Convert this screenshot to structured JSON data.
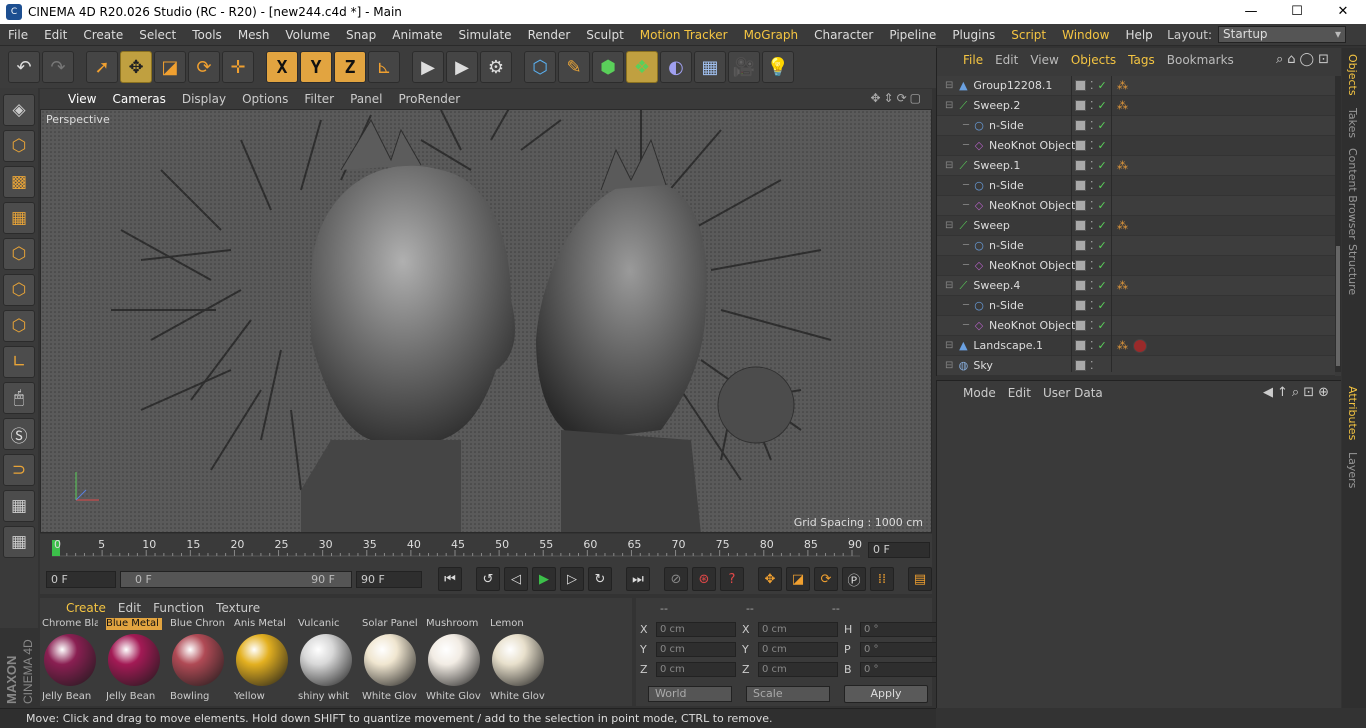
{
  "window": {
    "title": "CINEMA 4D R20.026 Studio (RC - R20) - [new244.c4d *] - Main",
    "minimize": "—",
    "maximize": "☐",
    "close": "✕"
  },
  "menubar": {
    "items": [
      "File",
      "Edit",
      "Create",
      "Select",
      "Tools",
      "Mesh",
      "Volume",
      "Snap",
      "Animate",
      "Simulate",
      "Render",
      "Sculpt",
      "Motion Tracker",
      "MoGraph",
      "Character",
      "Pipeline",
      "Plugins",
      "Script",
      "Window",
      "Help"
    ],
    "highlighted": [
      "Motion Tracker",
      "MoGraph",
      "Script",
      "Window"
    ],
    "layout_label": "Layout:",
    "layout_value": "Startup"
  },
  "viewport": {
    "menu": [
      "View",
      "Cameras",
      "Display",
      "Options",
      "Filter",
      "Panel",
      "ProRender"
    ],
    "label": "Perspective",
    "grid_spacing": "Grid Spacing : 1000 cm"
  },
  "timeline": {
    "ticks": [
      "0",
      "5",
      "10",
      "15",
      "20",
      "25",
      "30",
      "35",
      "40",
      "45",
      "50",
      "55",
      "60",
      "65",
      "70",
      "75",
      "80",
      "85",
      "90"
    ],
    "current_frame": "0 F"
  },
  "transport": {
    "start": "0 F",
    "range_start": "0 F",
    "range_end": "90 F",
    "end": "90 F"
  },
  "material_manager": {
    "menu": [
      "Create",
      "Edit",
      "Function",
      "Texture"
    ],
    "materials": [
      {
        "top": "Chrome Bla",
        "bottom": "Jelly Bean",
        "color": "#8a1f52",
        "selected": false
      },
      {
        "top": "Blue Metal",
        "bottom": "Jelly Bean",
        "color": "#a31a55",
        "selected": true
      },
      {
        "top": "Blue Chron",
        "bottom": "Bowling",
        "color": "#b04a55",
        "selected": false
      },
      {
        "top": "Anis Metal",
        "bottom": "Yellow",
        "color": "#e3b020",
        "selected": false
      },
      {
        "top": "Vulcanic",
        "bottom": "shiny whit",
        "color": "#d8d8d8",
        "selected": false
      },
      {
        "top": "Solar Panel",
        "bottom": "White Glov",
        "color": "#f0e6d0",
        "selected": false
      },
      {
        "top": "Mushroom",
        "bottom": "White Glov",
        "color": "#f2ece4",
        "selected": false
      },
      {
        "top": "Lemon",
        "bottom": "White Glov",
        "color": "#e8e0cc",
        "selected": false
      }
    ]
  },
  "coordinates": {
    "headers": [
      "--",
      "--",
      "--"
    ],
    "rows": [
      {
        "a": "X",
        "av": "0 cm",
        "b": "X",
        "bv": "0 cm",
        "c": "H",
        "cv": "0 °"
      },
      {
        "a": "Y",
        "av": "0 cm",
        "b": "Y",
        "bv": "0 cm",
        "c": "P",
        "cv": "0 °"
      },
      {
        "a": "Z",
        "av": "0 cm",
        "b": "Z",
        "bv": "0 cm",
        "c": "B",
        "cv": "0 °"
      }
    ],
    "mode1": "World",
    "mode2": "Scale",
    "apply": "Apply"
  },
  "status": "Move: Click and drag to move elements. Hold down SHIFT to quantize movement / add to the selection in point mode, CTRL to remove.",
  "object_manager": {
    "menu": [
      "File",
      "Edit",
      "View",
      "Objects",
      "Tags",
      "Bookmarks"
    ],
    "highlighted": [
      "File",
      "Objects",
      "Tags"
    ],
    "objects": [
      {
        "name": "Group12208.1",
        "level": 1,
        "icon": "null-icon",
        "glyph": "▲",
        "color": "#6aa0e0",
        "tags": true,
        "red": false
      },
      {
        "name": "Sweep.2",
        "level": 1,
        "icon": "sweep-icon",
        "glyph": "⟋",
        "color": "#5ad05a",
        "tags": true,
        "red": false
      },
      {
        "name": "n-Side",
        "level": 2,
        "icon": "spline-icon",
        "glyph": "○",
        "color": "#6aa0e0",
        "tags": false,
        "red": false
      },
      {
        "name": "NeoKnot Object",
        "level": 2,
        "icon": "knot-icon",
        "glyph": "◇",
        "color": "#b060c0",
        "tags": false,
        "red": false
      },
      {
        "name": "Sweep.1",
        "level": 1,
        "icon": "sweep-icon",
        "glyph": "⟋",
        "color": "#5ad05a",
        "tags": true,
        "red": false
      },
      {
        "name": "n-Side",
        "level": 2,
        "icon": "spline-icon",
        "glyph": "○",
        "color": "#6aa0e0",
        "tags": false,
        "red": false
      },
      {
        "name": "NeoKnot Object",
        "level": 2,
        "icon": "knot-icon",
        "glyph": "◇",
        "color": "#b060c0",
        "tags": false,
        "red": false
      },
      {
        "name": "Sweep",
        "level": 1,
        "icon": "sweep-icon",
        "glyph": "⟋",
        "color": "#5ad05a",
        "tags": true,
        "red": false
      },
      {
        "name": "n-Side",
        "level": 2,
        "icon": "spline-icon",
        "glyph": "○",
        "color": "#6aa0e0",
        "tags": false,
        "red": false
      },
      {
        "name": "NeoKnot Object",
        "level": 2,
        "icon": "knot-icon",
        "glyph": "◇",
        "color": "#b060c0",
        "tags": false,
        "red": false
      },
      {
        "name": "Sweep.4",
        "level": 1,
        "icon": "sweep-icon",
        "glyph": "⟋",
        "color": "#5ad05a",
        "tags": true,
        "red": false
      },
      {
        "name": "n-Side",
        "level": 2,
        "icon": "spline-icon",
        "glyph": "○",
        "color": "#6aa0e0",
        "tags": false,
        "red": false
      },
      {
        "name": "NeoKnot Object",
        "level": 2,
        "icon": "knot-icon",
        "glyph": "◇",
        "color": "#b060c0",
        "tags": false,
        "red": false
      },
      {
        "name": "Landscape.1",
        "level": 1,
        "icon": "landscape-icon",
        "glyph": "▲",
        "color": "#6aa0e0",
        "tags": true,
        "red": true
      },
      {
        "name": "Sky",
        "level": 1,
        "icon": "sky-icon",
        "glyph": "◍",
        "color": "#8ab0e0",
        "tags": false,
        "red": false
      }
    ]
  },
  "attribute_manager": {
    "menu": [
      "Mode",
      "Edit",
      "User Data"
    ]
  },
  "side_tabs": {
    "top": [
      "Objects",
      "Takes",
      "Content Browser",
      "Structure"
    ],
    "bottom": [
      "Attributes",
      "Layers"
    ]
  },
  "maxon_logo": "MAXON CINEMA 4D"
}
